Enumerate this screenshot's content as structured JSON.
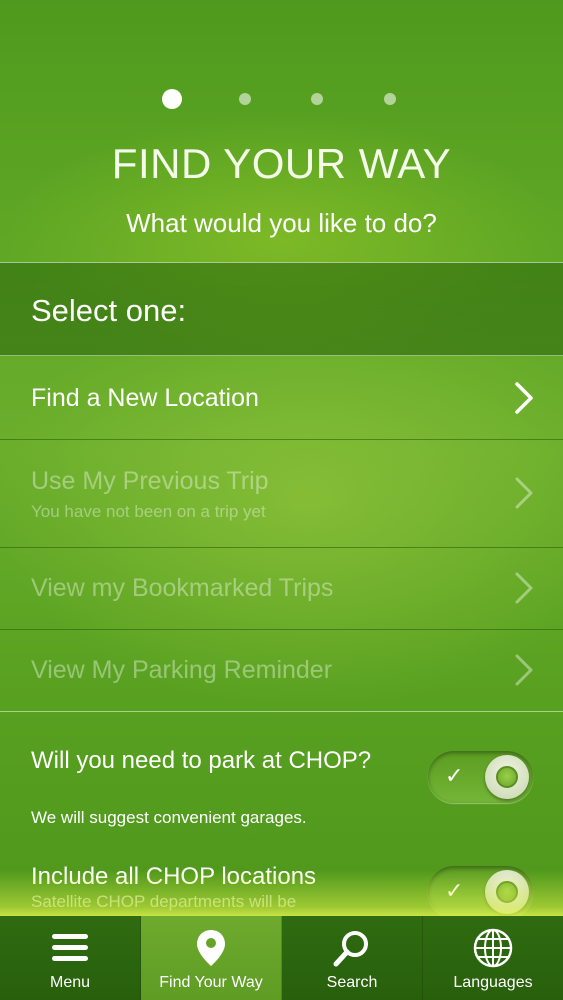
{
  "pager": {
    "page_count": 4,
    "active_index": 0
  },
  "header": {
    "title": "FIND YOUR WAY",
    "subtitle": "What would you like to do?"
  },
  "select_header": "Select one:",
  "options": [
    {
      "label": "Find a New Location",
      "sub": "",
      "enabled": true
    },
    {
      "label": "Use My Previous Trip",
      "sub": "You have not been on a trip yet",
      "enabled": false
    },
    {
      "label": "View my Bookmarked Trips",
      "sub": "",
      "enabled": false
    },
    {
      "label": "View My Parking Reminder",
      "sub": "",
      "enabled": false
    }
  ],
  "toggles": [
    {
      "label": "Will you need to park at CHOP?",
      "sub": "We will suggest convenient garages.",
      "on": true
    },
    {
      "label": "Include all CHOP locations",
      "sub": "Satellite CHOP departments will be",
      "on": true
    }
  ],
  "tabbar": [
    {
      "label": "Menu",
      "icon": "menu-icon",
      "active": false
    },
    {
      "label": "Find Your Way",
      "icon": "location-pin-icon",
      "active": true
    },
    {
      "label": "Search",
      "icon": "search-icon",
      "active": false
    },
    {
      "label": "Languages",
      "icon": "globe-icon",
      "active": false
    }
  ],
  "colors": {
    "background": "#5ea624",
    "tabbar": "#2f6b10",
    "tab_active": "#6eaa2e"
  }
}
